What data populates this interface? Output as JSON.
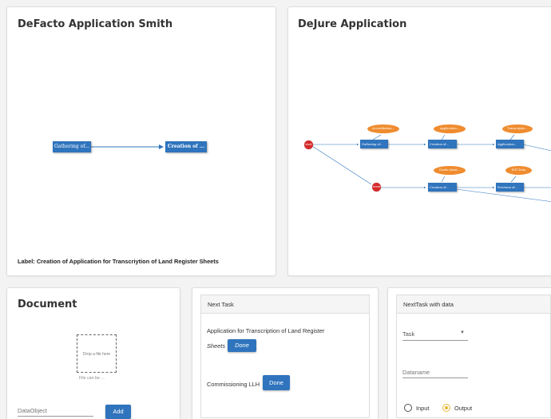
{
  "defacto": {
    "title": "DeFacto Application Smith",
    "nodes": [
      "Gathering of...",
      "Creation of ..."
    ],
    "label": "Label: Creation of Application for Transcriytion of Land Register Sheets"
  },
  "dejure": {
    "title": "DeJure Application",
    "start_event": "start",
    "mid_event": "event",
    "row1_boxes": [
      "Gathering of...",
      "Creation of...",
      "Application..."
    ],
    "row1_bubbles": [
      "Accreditation...",
      "Application...",
      "Transcriptio..."
    ],
    "row2_boxes": [
      "Creation of...",
      "Provision of..."
    ],
    "row2_bubbles": [
      "Goods about...",
      "ISIT Data"
    ]
  },
  "document": {
    "title": "Document",
    "dropzone": "Drop a file here",
    "note": "File can be ...",
    "dataobject_placeholder": "DataObject",
    "add_label": "Add"
  },
  "next_task": {
    "header": "Next Task",
    "task1": "Application for Transcription of Land Register",
    "task1_cont": "Sheets",
    "task2": "Commissioning LLH",
    "done_label": "Done"
  },
  "next_task_data": {
    "header": "NextTask with data",
    "task_select": "Task",
    "dataname_placeholder": "Dataname",
    "input_label": "Input",
    "output_label": "Output"
  },
  "colors": {
    "primary": "#2f74bd",
    "bubble": "#ef8c2f",
    "event": "#d62b2b",
    "radio_selected": "#ecb83a"
  }
}
